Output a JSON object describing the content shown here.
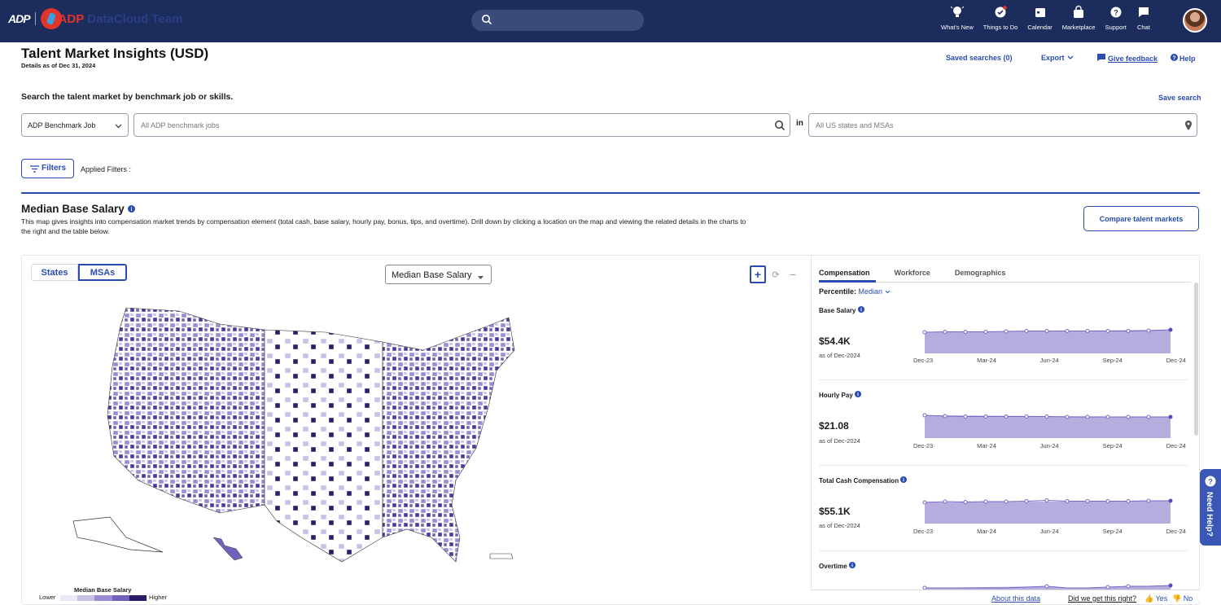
{
  "header": {
    "logo": "ADP",
    "brand": "ADP",
    "brand_sub": "DataCloud Team",
    "nav": [
      {
        "icon": "lightbulb-icon",
        "label": "What's New"
      },
      {
        "icon": "checkmark-icon",
        "label": "Things to Do"
      },
      {
        "icon": "calendar-icon",
        "label": "Calendar"
      },
      {
        "icon": "shopping-bag-icon",
        "label": "Marketplace"
      },
      {
        "icon": "help-icon",
        "label": "Support"
      },
      {
        "icon": "chat-icon",
        "label": "Chat"
      }
    ]
  },
  "page": {
    "title": "Talent Market Insights (USD)",
    "subtitle": "Details as of Dec 31, 2024",
    "saved_searches": "Saved searches (0)",
    "export": "Export",
    "feedback": "Give feedback",
    "help": "Help"
  },
  "search": {
    "label": "Search the talent market by benchmark job or skills.",
    "save_search": "Save search",
    "type_value": "ADP Benchmark Job",
    "job_placeholder": "All ADP benchmark jobs",
    "in_label": "in",
    "location_placeholder": "All US states and MSAs"
  },
  "filters": {
    "button": "Filters",
    "applied": "Applied Filters :"
  },
  "section": {
    "title": "Median Base Salary",
    "description": "This map gives insights into compensation market trends by compensation element (total cash, base salary, hourly pay, bonus, tips, and overtime). Drill down by clicking a location on the map and viewing the related details in the charts to the right and the table below.",
    "compare_button": "Compare talent markets"
  },
  "map": {
    "toggle": [
      "States",
      "MSAs"
    ],
    "selected_toggle": "MSAs",
    "metric_select": "Median Base Salary",
    "zoom_in": "+",
    "zoom_reset": "⟳",
    "zoom_out": "−",
    "legend": {
      "title": "Median Base Salary",
      "low": "Lower",
      "high": "Higher"
    }
  },
  "colors": {
    "accent": "#2a4bb0",
    "navbar": "#1c2c5c",
    "scale": [
      "#ece9f6",
      "#c9c0e6",
      "#9c8bd2",
      "#7261bb",
      "#4d3a98",
      "#2c1d66"
    ],
    "chart_fill": "#b7acde",
    "chart_line": "#7a66c8"
  },
  "panel": {
    "tabs": [
      "Compensation",
      "Workforce",
      "Demographics"
    ],
    "active_tab": "Compensation",
    "percentile_label": "Percentile:",
    "percentile_value": "Median",
    "as_of": "as of Dec-2024",
    "x_labels": [
      "Dec-23",
      "Mar-24",
      "Jun-24",
      "Sep-24",
      "Dec-24"
    ],
    "metrics": [
      {
        "name": "Base Salary",
        "value": "$54.4K"
      },
      {
        "name": "Hourly Pay",
        "value": "$21.08"
      },
      {
        "name": "Total Cash Compensation",
        "value": "$55.1K"
      },
      {
        "name": "Overtime",
        "value": ""
      }
    ]
  },
  "footer": {
    "about": "About this data",
    "question": "Did we get this right?",
    "yes": "Yes",
    "no": "No"
  },
  "need_help": "Need Help?"
}
